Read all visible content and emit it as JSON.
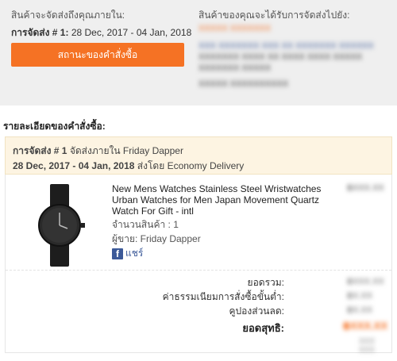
{
  "top": {
    "left_title": "สินค้าจะจัดส่งถึงคุณภายใน:",
    "shipment_label": "การจัดส่ง # 1:",
    "shipment_dates": "28 Dec, 2017 - 04 Jan, 2018",
    "status_button": "สถานะของคำสั่งซื้อ",
    "right_title": "สินค้าของคุณจะได้รับการจัดส่งไปยัง:",
    "address": {
      "name": "XXXXX XXXXXXX",
      "line1": "XXX XXXXXXX XXX XX XXXXXXX XXXXXX",
      "line2": "XXXXXXX XXXX XX XXXX XXXX XXXXX",
      "line3": "XXXXXXX XXXXX",
      "phone": "XXXXX XXXXXXXXXX"
    }
  },
  "section_title": "รายละเอียดของคำสั่งซื้อ:",
  "package": {
    "shipment_label": "การจัดส่ง # 1",
    "ship_within_text": "จัดส่งภายใน Friday Dapper",
    "dates": "28 Dec, 2017 - 04 Jan, 2018",
    "delivery_text": "ส่งโดย Economy Delivery"
  },
  "item": {
    "title": "New Mens Watches Stainless Steel Wristwatches Urban Watches for Men Japan Movement Quartz Watch For Gift - intl",
    "quantity": "จำนวนสินค้า : 1",
    "seller": "ผู้ขาย: Friday Dapper",
    "share_label": "แชร์",
    "price": "฿XXX.XX"
  },
  "summary": {
    "subtotal_label": "ยอดรวม:",
    "subtotal_value": "฿XXX.XX",
    "fee_label": "ค่าธรรมเนียมการสั่งซื้อขั้นต่ำ:",
    "fee_value": "฿X.XX",
    "coupon_label": "คูปองส่วนลด:",
    "coupon_value": "฿X.XX",
    "total_label": "ยอดสุทธิ:",
    "total_value": "฿XXX.XX",
    "total_note": "XXX XXX"
  },
  "colors": {
    "accent": "#f57224",
    "facebook": "#3b5998",
    "package_bg": "#fdf4e2",
    "top_bg": "#efefef"
  }
}
